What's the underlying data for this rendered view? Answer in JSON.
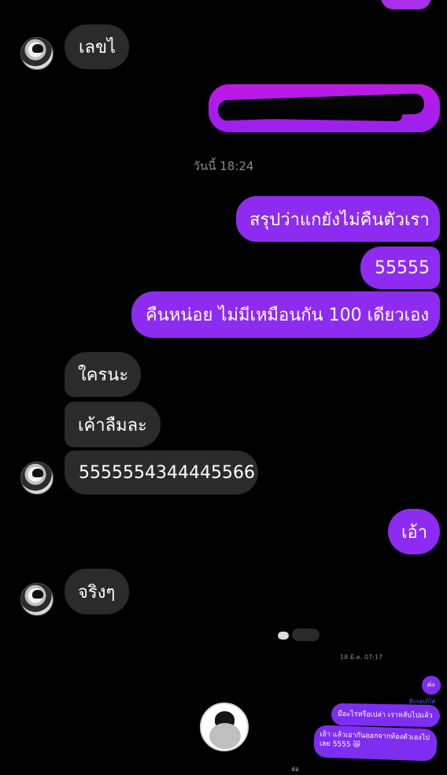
{
  "conversation": {
    "incoming_1": "เลขไ",
    "timestamp": "วันนี้ 18:24",
    "outgoing_1": "สรุปว่าแกยังไม่คืนตัวเรา",
    "outgoing_2": "55555",
    "outgoing_3": "คืนหน่อย ไม่มีเหมือนกัน 100 เดียวเอง",
    "incoming_2": "ใครนะ",
    "incoming_3": "เค้าลืมละ",
    "incoming_4": "5555554344445566",
    "outgoing_4": "เอ้า",
    "incoming_5": "จริงๆ"
  },
  "embedded_screenshot": {
    "timestamp": "18 มิ.ค. 07:17",
    "bubble_small": "ค่ะ",
    "seen_label": "อีกรอบก็ได้",
    "message_1": "มีอะไรหรือเปล่า เราหลับไปแล้ว",
    "message_2_line1": "เอ้า แล้วเอากันออกจากห้องตัวเองไป",
    "message_2_line2": "เลย 5555 😿",
    "footer_text": "ฮ่อ"
  },
  "colors": {
    "background": "#000000",
    "incoming_bubble": "#2b2b2b",
    "outgoing_bubble": "#8e2bf1",
    "timestamp": "#8a8a8a"
  },
  "icons": {
    "avatar": "avatar-icon"
  }
}
